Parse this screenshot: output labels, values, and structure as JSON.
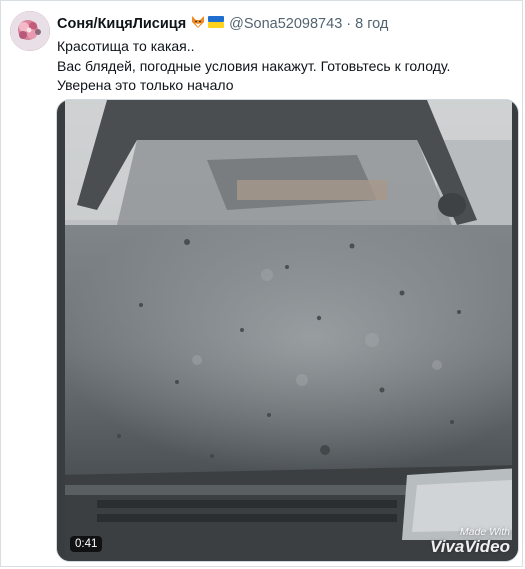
{
  "tweet": {
    "author_name": "Соня/КицяЛисиця",
    "author_emoji": "🦊🇺🇦",
    "handle": "@Sona52098743",
    "separator": "·",
    "time": "8 год",
    "text_lines": [
      "Красотища то какая..",
      "Вас блядей, погодные условия накажут. Готовьтесь к голоду.",
      "Уверена это только начало"
    ]
  },
  "video": {
    "duration": "0:41",
    "watermark_top": "Made With",
    "watermark_brand": "VivaVideo"
  },
  "icons": {
    "avatar": "profile-picture",
    "fox": "fox-emoji",
    "flag": "ukraine-flag-emoji"
  }
}
